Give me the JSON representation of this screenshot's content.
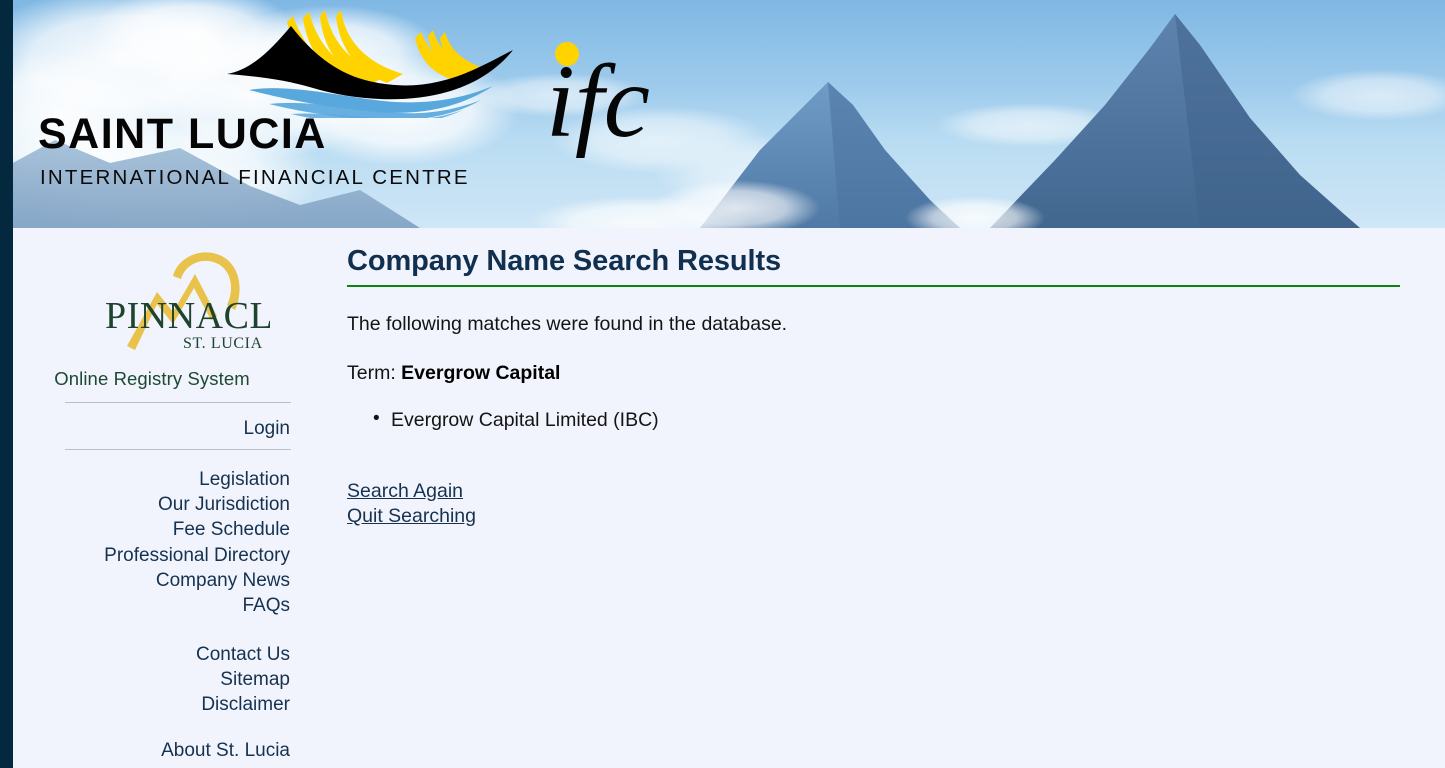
{
  "banner": {
    "logo_title": "SAINT LUCIA",
    "logo_subtitle": "INTERNATIONAL FINANCIAL CENTRE",
    "ifc_mark": "ifc",
    "colors": {
      "sky": "#9ecbec",
      "mountain": "#5b86b5",
      "logo_yellow": "#ffd400",
      "logo_blue": "#55a7db",
      "logo_black": "#000000"
    }
  },
  "sidebar": {
    "logo": {
      "word": "PINNACLE",
      "sub": "ST. LUCIA",
      "colors": {
        "peak": "#e8c24a",
        "text": "#1e4430"
      }
    },
    "system_label": "Online Registry System",
    "login": {
      "label": "Login"
    },
    "group_primary": [
      {
        "label": "Legislation"
      },
      {
        "label": "Our Jurisdiction"
      },
      {
        "label": "Fee Schedule"
      },
      {
        "label": "Professional Directory"
      },
      {
        "label": "Company News"
      },
      {
        "label": "FAQs"
      }
    ],
    "group_secondary": [
      {
        "label": "Contact Us"
      },
      {
        "label": "Sitemap"
      },
      {
        "label": "Disclaimer"
      }
    ],
    "group_tertiary": [
      {
        "label": "About St. Lucia"
      }
    ]
  },
  "main": {
    "title": "Company Name Search Results",
    "intro": "The following matches were found in the database.",
    "term_label": "Term:",
    "term_value": "Evergrow Capital",
    "results": [
      {
        "label": "Evergrow Capital Limited (IBC)"
      }
    ],
    "links": [
      {
        "label": "Search Again"
      },
      {
        "label": "Quit Searching"
      }
    ]
  },
  "theme": {
    "page_background": "#f1f4fd",
    "rail": "#04293f",
    "heading": "#11304f",
    "rule_green": "#0e8210",
    "link": "#16324f"
  }
}
